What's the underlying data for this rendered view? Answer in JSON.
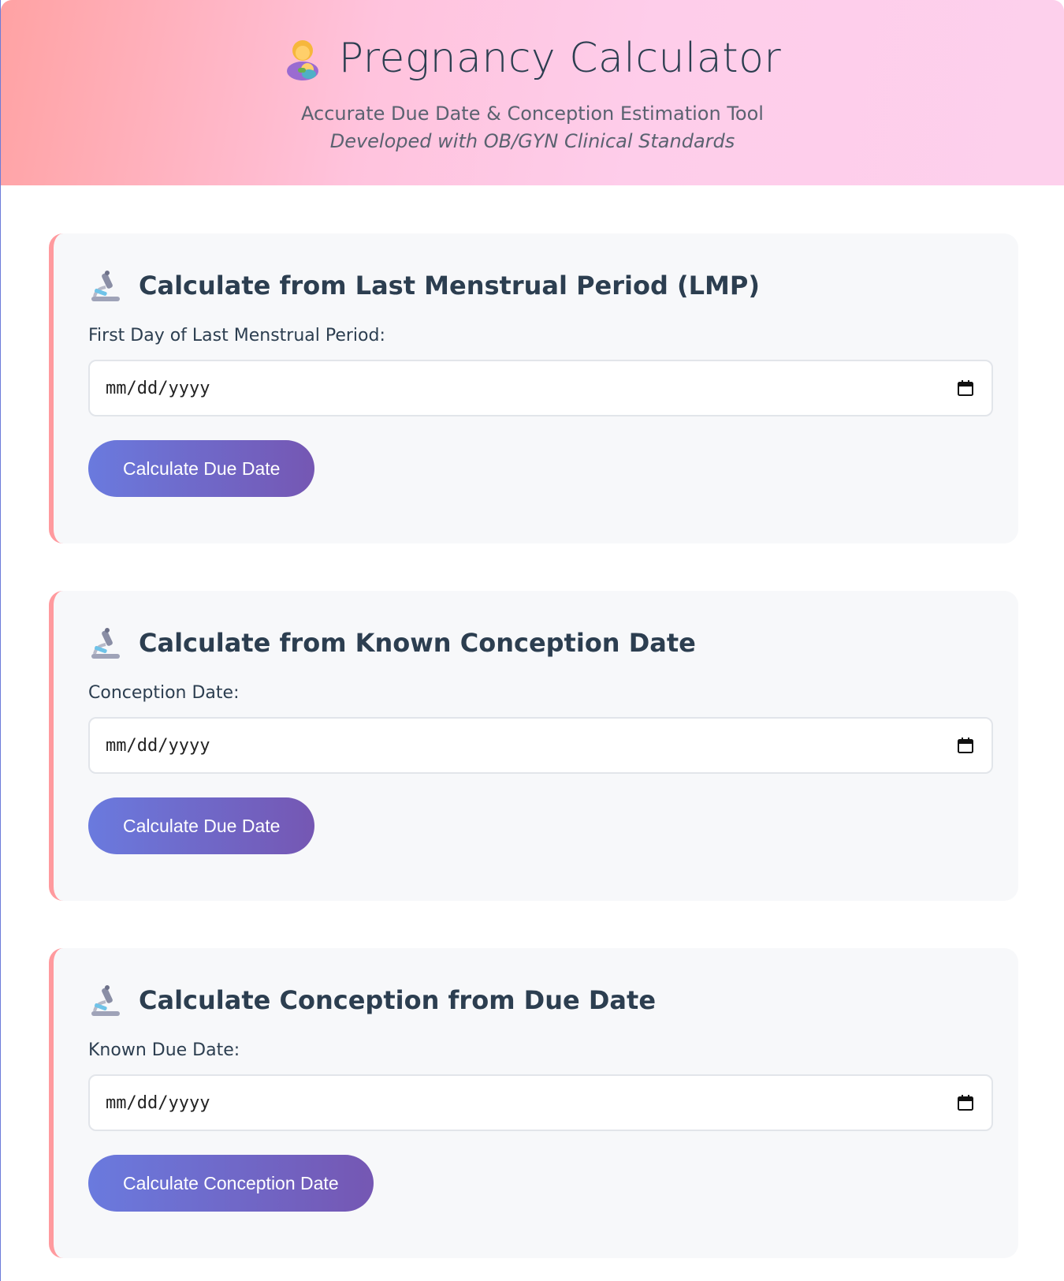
{
  "header": {
    "title": "Pregnancy Calculator",
    "title_icon": "woman-feeding-baby-icon",
    "subtitle": "Accurate Due Date & Conception Estimation Tool",
    "tagline": "Developed with OB/GYN Clinical Standards"
  },
  "colors": {
    "header_gradient_start": "#ffa2a3",
    "header_gradient_end": "#fdd0ec",
    "card_accent": "#ff9a9e",
    "button_gradient_start": "#6a7ade",
    "button_gradient_end": "#7557b3"
  },
  "cards": [
    {
      "icon": "microscope-icon",
      "title": "Calculate from Last Menstrual Period (LMP)",
      "label": "First Day of Last Menstrual Period:",
      "input_placeholder": "mm/dd/yyyy",
      "input_icon": "calendar-icon",
      "button": "Calculate Due Date"
    },
    {
      "icon": "microscope-icon",
      "title": "Calculate from Known Conception Date",
      "label": "Conception Date:",
      "input_placeholder": "mm/dd/yyyy",
      "input_icon": "calendar-icon",
      "button": "Calculate Due Date"
    },
    {
      "icon": "microscope-icon",
      "title": "Calculate Conception from Due Date",
      "label": "Known Due Date:",
      "input_placeholder": "mm/dd/yyyy",
      "input_icon": "calendar-icon",
      "button": "Calculate Conception Date"
    }
  ]
}
